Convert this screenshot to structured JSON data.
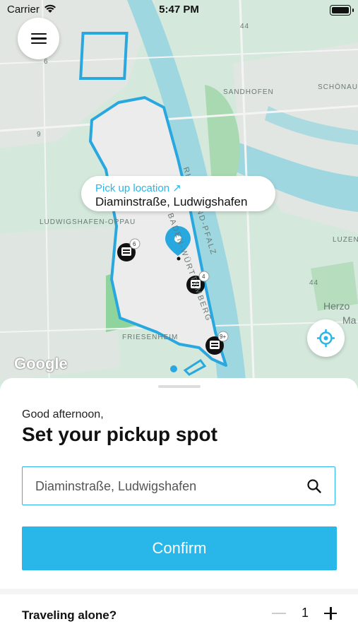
{
  "status_bar": {
    "carrier": "Carrier",
    "time": "5:47 PM"
  },
  "map": {
    "labels": {
      "sandhofen": "SANDHOFEN",
      "schonau": "SCHÖNAU",
      "ludwigshafen_oppau": "LUDWIGSHAFEN-OPPAU",
      "friesenheim": "FRIESENHEIM",
      "lucen": "LUZEN",
      "herzog": "Herzo",
      "herzog2": "Ma",
      "road_44_top": "44",
      "road_44_right": "44",
      "road_6": "6",
      "road_9": "9",
      "bawu": "BADEN-WÜRTTEMBERG",
      "rhein": "RHEINLAND-PFALZ"
    },
    "pickup_bubble": {
      "label": "Pick up location ↗",
      "address": "Diaminstraße, Ludwigshafen"
    },
    "vehicle_badges": [
      "6",
      "4",
      "9+"
    ],
    "google_logo": "Google",
    "colors": {
      "zone": "#29a7df",
      "water": "#9fd7e0",
      "land": "#d4e8dc"
    }
  },
  "sheet": {
    "greeting": "Good afternoon,",
    "title": "Set your pickup spot",
    "search_value": "Diaminstraße, Ludwigshafen",
    "confirm_label": "Confirm",
    "traveling_label": "Traveling alone?",
    "passenger_count": "1"
  }
}
